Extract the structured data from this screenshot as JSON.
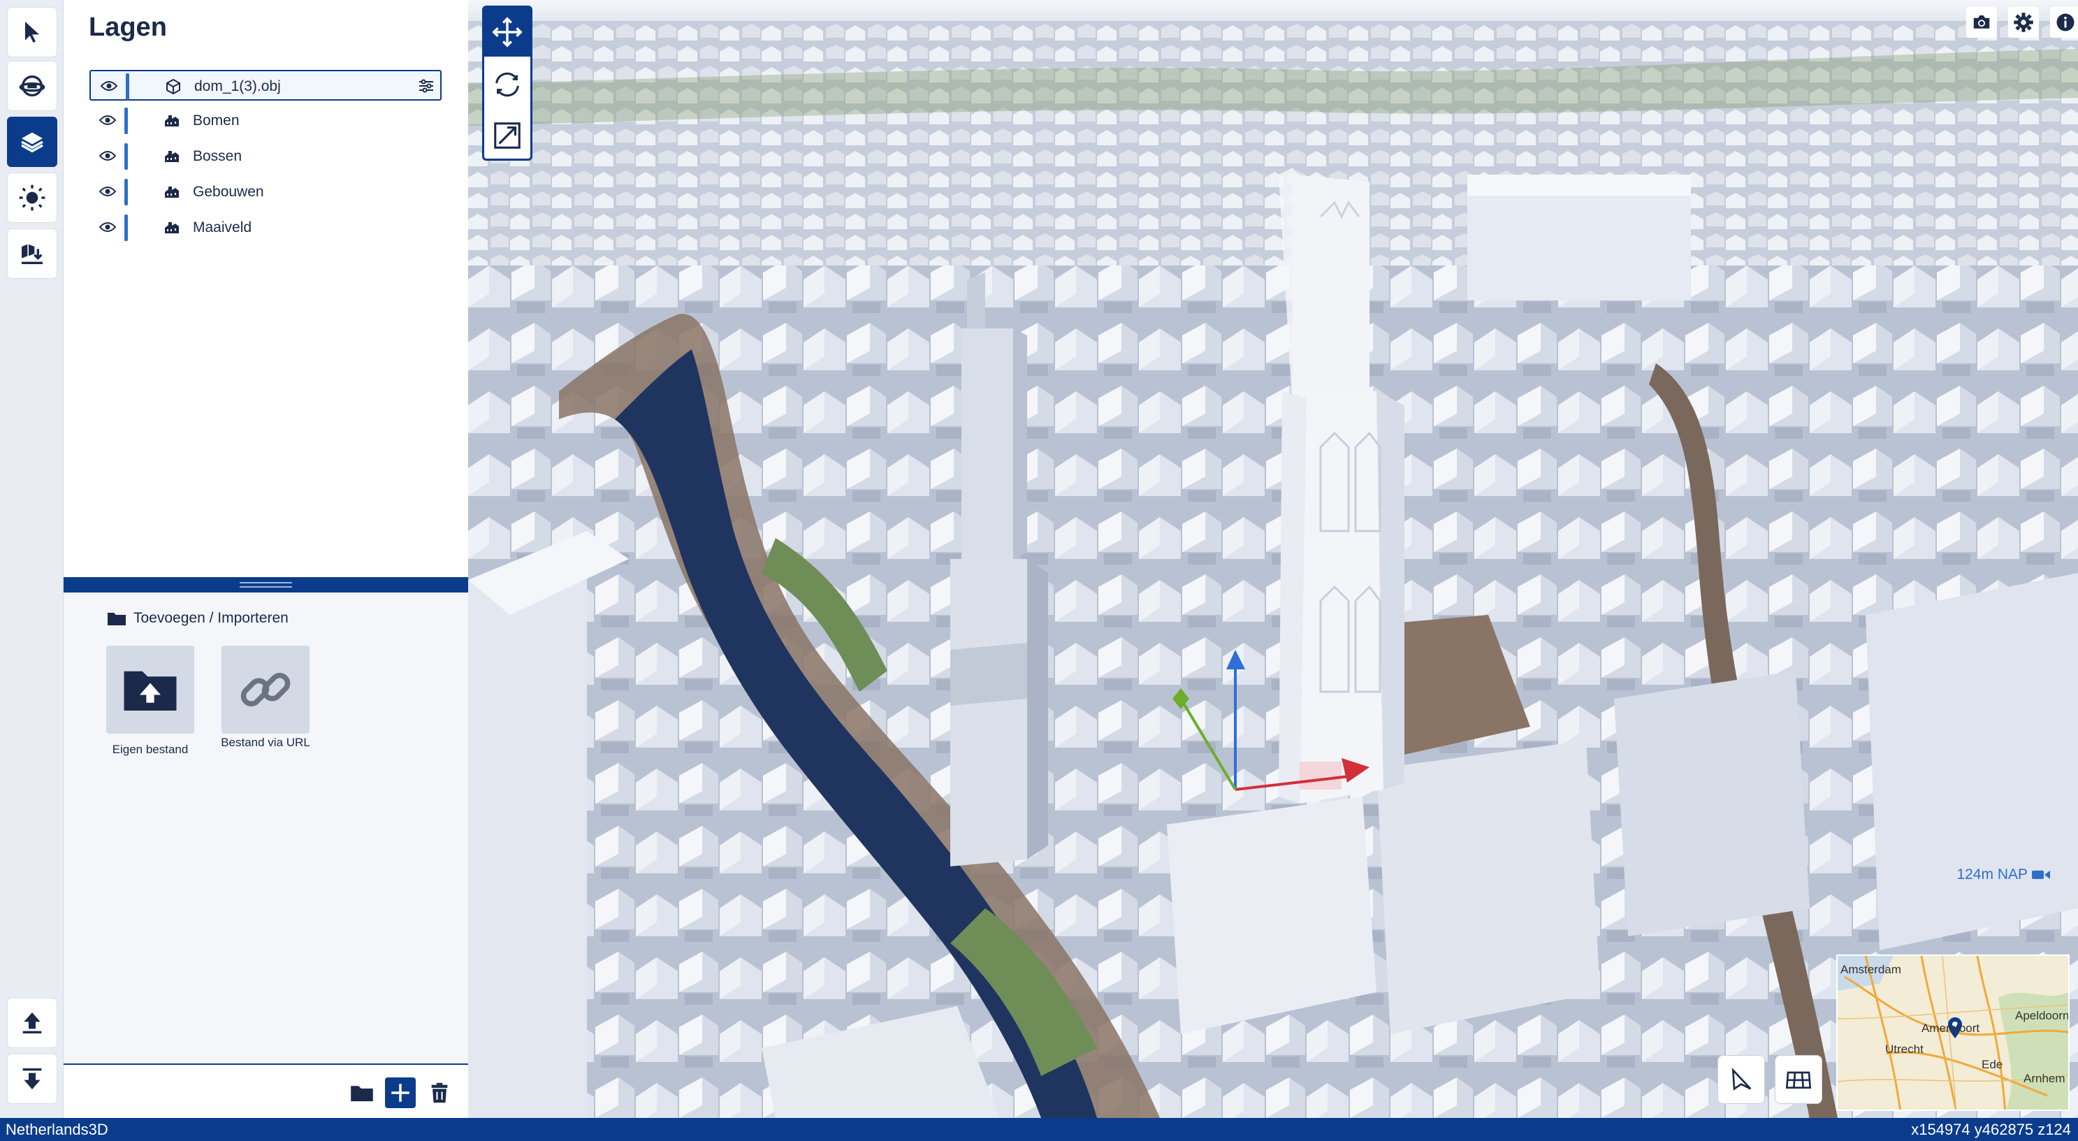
{
  "toolbar": {
    "items": [
      {
        "name": "select-tool",
        "icon": "cursor-icon"
      },
      {
        "name": "camera-view",
        "icon": "globe-icon"
      },
      {
        "name": "layers",
        "icon": "layers-icon",
        "active": true
      },
      {
        "name": "sun-settings",
        "icon": "sun-icon"
      },
      {
        "name": "import-data",
        "icon": "map-import-icon"
      }
    ],
    "bottom": [
      {
        "name": "upload",
        "icon": "upload-icon"
      },
      {
        "name": "download",
        "icon": "download-icon"
      }
    ]
  },
  "panel": {
    "title": "Lagen",
    "layers": [
      {
        "label": "dom_1(3).obj",
        "icon": "cube-icon",
        "selected": true
      },
      {
        "label": "Bomen",
        "icon": "buildings-icon"
      },
      {
        "label": "Bossen",
        "icon": "buildings-icon"
      },
      {
        "label": "Gebouwen",
        "icon": "buildings-icon"
      },
      {
        "label": "Maaiveld",
        "icon": "buildings-icon"
      }
    ],
    "add_section": {
      "title": "Toevoegen / Importeren",
      "tiles": [
        {
          "label": "Eigen bestand",
          "icon": "folder-upload-icon"
        },
        {
          "label": "Bestand via URL",
          "icon": "link-icon"
        }
      ]
    },
    "footer": [
      "folder-icon",
      "plus-icon",
      "trash-icon"
    ]
  },
  "viewport": {
    "transform_tools": [
      "move-icon",
      "rotate-icon",
      "scale-icon"
    ],
    "top_right": [
      "camera-icon",
      "gear-icon",
      "info-icon"
    ],
    "nap_label": "124m NAP",
    "map_buttons": [
      "north-arrow-icon",
      "grid-icon"
    ],
    "minimap_cities": [
      "Amsterdam",
      "Amersfoort",
      "Utrecht",
      "Apeldoorn",
      "Ede",
      "Arnhem"
    ]
  },
  "status": {
    "left": "Netherlands3D",
    "right": "x154974 y462875 z124"
  },
  "colors": {
    "brand": "#0b3c8c",
    "accent": "#2d6fc7",
    "status_bar": "#0b3c8c"
  }
}
